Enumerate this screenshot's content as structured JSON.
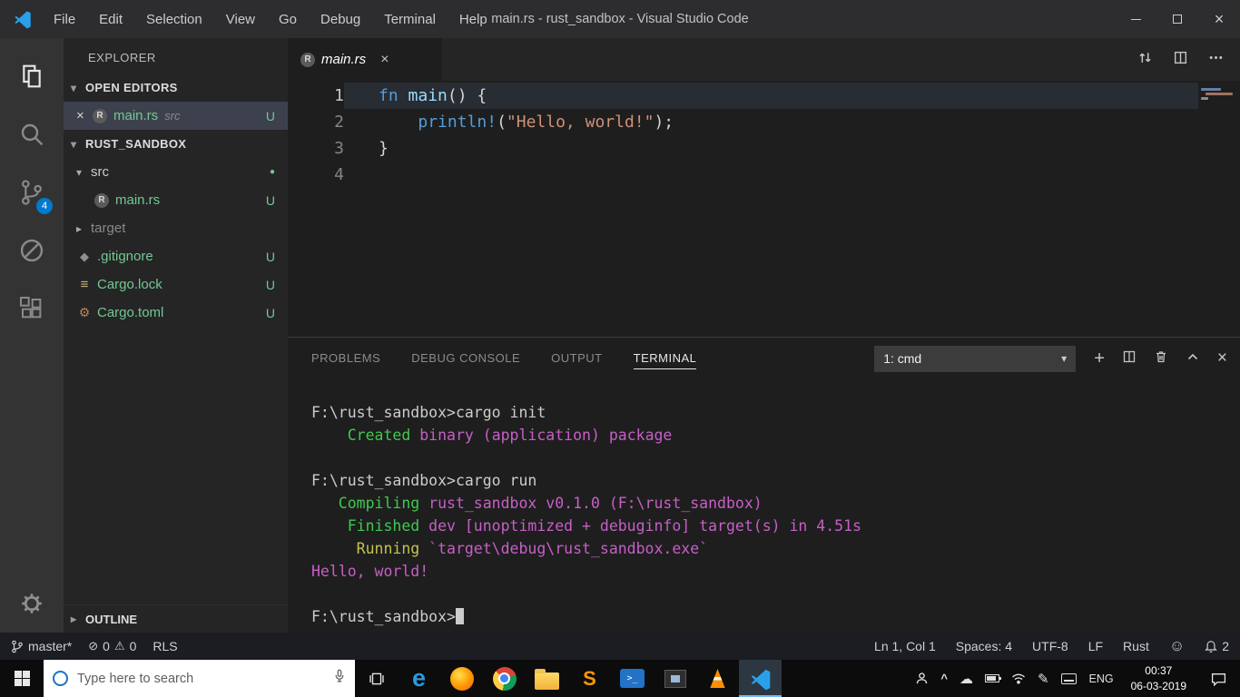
{
  "colors": {
    "titlebar": "#2d2d30",
    "activitybar": "#333333",
    "sidebar": "#252526",
    "editor": "#1e1e1e",
    "tabbar": "#252526",
    "statusbar": "#1b1d23",
    "taskbar": "#0c0c0c",
    "accent": "#007acc",
    "selection": "#3c414d",
    "linehl": "#282c33",
    "dropdown": "#3c3c3c",
    "untracked": "#73c991"
  },
  "palette": {
    "kw": "#569cd6",
    "id": "#9cdcfe",
    "fg": "#d4d4d4",
    "str": "#ce9178",
    "t": "#cccccc",
    "g": "#3ec94e",
    "y": "#c3c34f",
    "m": "#c75fc7"
  },
  "glyphs": {
    "close": "×",
    "ellipsis": "⋯",
    "plus": "+",
    "caret": "▾",
    "expanded": "▾",
    "collapsed": "▸",
    "git": "◆",
    "lock": "≡",
    "toml": "⚙",
    "dot": "●",
    "error": "⊘",
    "warning": "⚠",
    "smiley": "☺",
    "cloud": "☁",
    "pen": "✎",
    "tray_chevron": "^"
  },
  "title_bar": {
    "menus": [
      "File",
      "Edit",
      "Selection",
      "View",
      "Go",
      "Debug",
      "Terminal",
      "Help"
    ],
    "title": "main.rs - rust_sandbox - Visual Studio Code"
  },
  "activity_bar": {
    "scm_badge": "4"
  },
  "sidebar": {
    "header": "EXPLORER",
    "open_editors_label": "OPEN EDITORS",
    "open_editor": {
      "name": "main.rs",
      "detail": "src",
      "badge": "U",
      "rust_icon_letter": "R"
    },
    "root_label": "RUST_SANDBOX",
    "outline_label": "OUTLINE",
    "tree": {
      "items": [
        {
          "level": 0,
          "chevron": "down",
          "icon": "",
          "label": "src",
          "color": "fg",
          "badge": "dot"
        },
        {
          "level": 1,
          "chevron": "",
          "icon": "rust",
          "label": "main.rs",
          "color": "green",
          "badge": "U"
        },
        {
          "level": 0,
          "chevron": "right",
          "icon": "",
          "label": "target",
          "color": "muted",
          "badge": ""
        },
        {
          "level": 0,
          "chevron": "",
          "icon": "git",
          "label": ".gitignore",
          "color": "green",
          "badge": "U"
        },
        {
          "level": 0,
          "chevron": "",
          "icon": "lock",
          "label": "Cargo.lock",
          "color": "green",
          "badge": "U"
        },
        {
          "level": 0,
          "chevron": "",
          "icon": "toml",
          "label": "Cargo.toml",
          "color": "green",
          "badge": "U"
        }
      ]
    }
  },
  "editor": {
    "tab_label": "main.rs",
    "rust_icon_letter": "R",
    "code_lines": [
      {
        "num": "1",
        "current": true,
        "tokens": [
          {
            "t": "fn ",
            "c": "kw"
          },
          {
            "t": "main",
            "c": "id"
          },
          {
            "t": "() {",
            "c": "fg"
          }
        ]
      },
      {
        "num": "2",
        "tokens": [
          {
            "t": "    ",
            "c": "fg"
          },
          {
            "t": "println!",
            "c": "kw"
          },
          {
            "t": "(",
            "c": "fg"
          },
          {
            "t": "\"Hello, world!\"",
            "c": "str"
          },
          {
            "t": ");",
            "c": "fg"
          }
        ]
      },
      {
        "num": "3",
        "tokens": [
          {
            "t": "}",
            "c": "fg"
          }
        ]
      },
      {
        "num": "4",
        "tokens": []
      }
    ]
  },
  "panel": {
    "tabs": [
      "PROBLEMS",
      "DEBUG CONSOLE",
      "OUTPUT",
      "TERMINAL"
    ],
    "active_index": 3,
    "dropdown_value": "1: cmd"
  },
  "terminal": {
    "lines": [
      {
        "segs": [
          {
            "t": "F:\\rust_sandbox>cargo init",
            "c": "t"
          }
        ]
      },
      {
        "segs": [
          {
            "t": "    Created ",
            "c": "g"
          },
          {
            "t": "binary (application) package",
            "c": "m"
          }
        ]
      },
      {
        "segs": []
      },
      {
        "segs": [
          {
            "t": "F:\\rust_sandbox>cargo run",
            "c": "t"
          }
        ]
      },
      {
        "segs": [
          {
            "t": "   Compiling ",
            "c": "g"
          },
          {
            "t": "rust_sandbox v0.1.0 (F:\\rust_sandbox)",
            "c": "m"
          }
        ]
      },
      {
        "segs": [
          {
            "t": "    Finished ",
            "c": "g"
          },
          {
            "t": "dev [unoptimized + debuginfo] target(s) in 4.51s",
            "c": "m"
          }
        ]
      },
      {
        "segs": [
          {
            "t": "     Running ",
            "c": "y"
          },
          {
            "t": "`target\\debug\\rust_sandbox.exe`",
            "c": "m"
          }
        ]
      },
      {
        "segs": [
          {
            "t": "Hello, world!",
            "c": "m"
          }
        ]
      },
      {
        "segs": []
      },
      {
        "segs": [
          {
            "t": "F:\\rust_sandbox>",
            "c": "t"
          }
        ],
        "cursor": true
      }
    ]
  },
  "status_bar": {
    "branch": "master*",
    "errors": "0",
    "warnings": "0",
    "rls": "RLS",
    "right": [
      {
        "name": "cursor-position",
        "label": "Ln 1, Col 1"
      },
      {
        "name": "indentation",
        "label": "Spaces: 4"
      },
      {
        "name": "encoding",
        "label": "UTF-8"
      },
      {
        "name": "eol",
        "label": "LF"
      },
      {
        "name": "language-mode",
        "label": "Rust"
      }
    ],
    "bell_count": "2"
  },
  "taskbar": {
    "search_placeholder": "Type here to search",
    "lang": "ENG",
    "time": "00:37",
    "date": "06-03-2019"
  }
}
